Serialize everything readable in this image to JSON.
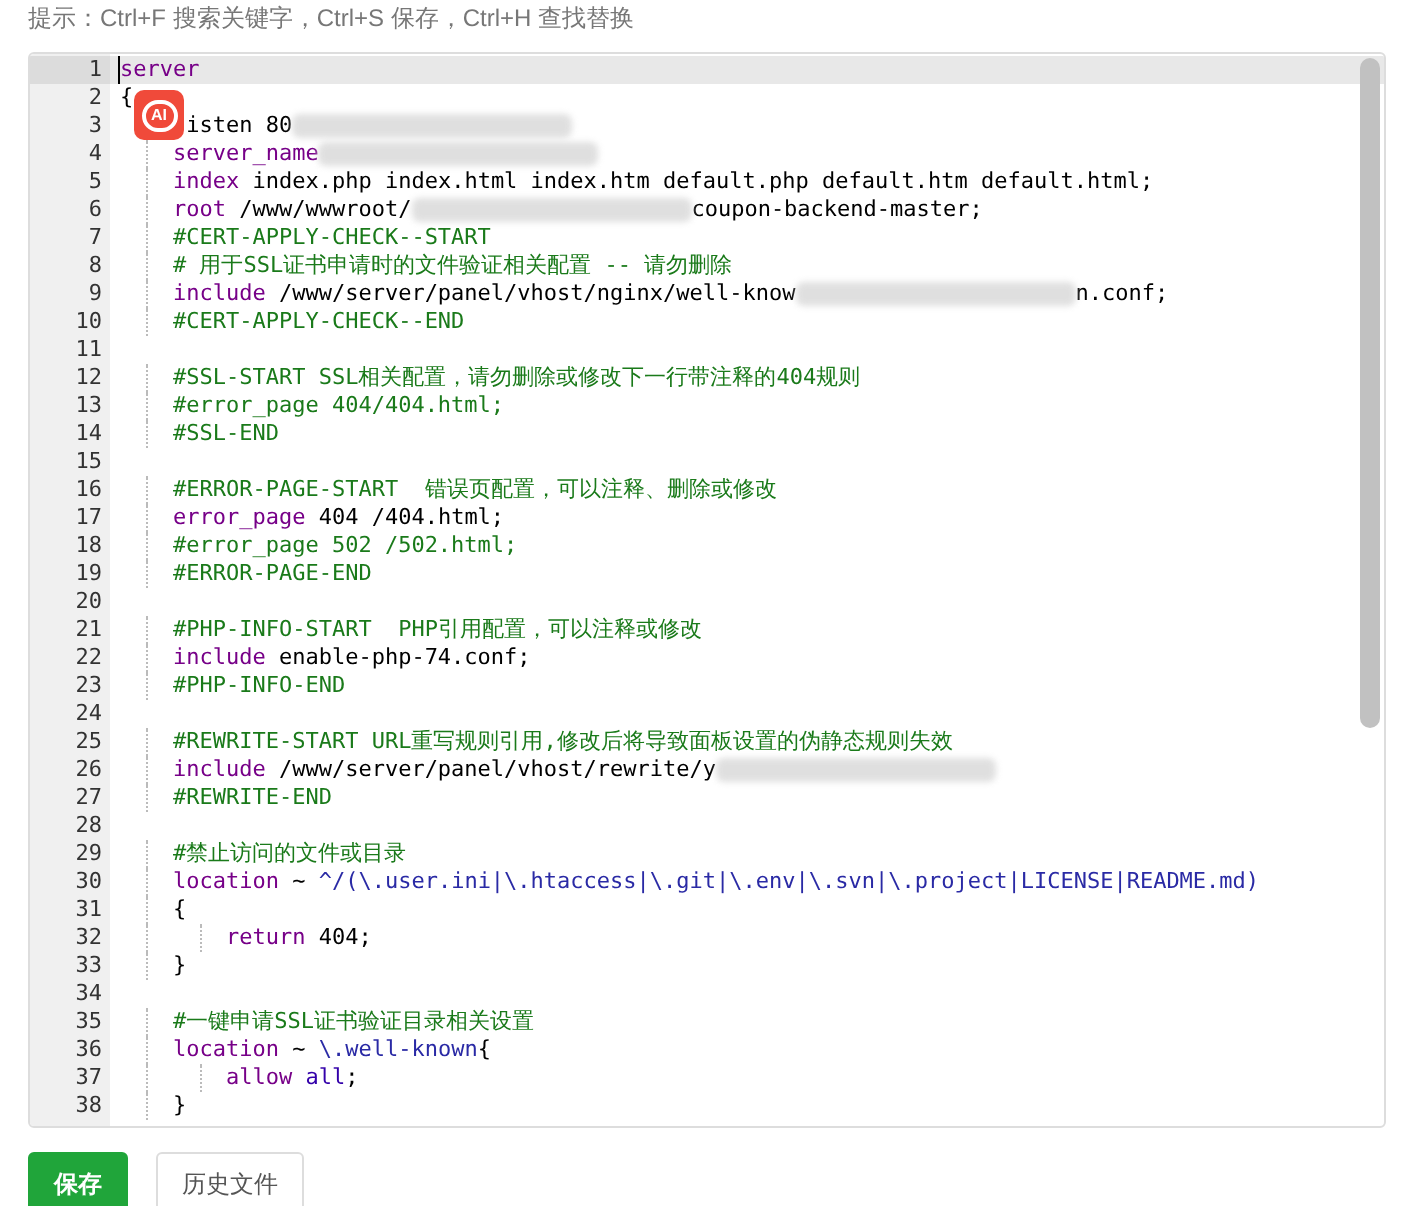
{
  "hint": "提示：Ctrl+F 搜索关键字，Ctrl+S 保存，Ctrl+H 查找替换",
  "editor": {
    "ai_badge": "AI",
    "lines": [
      {
        "number": "1",
        "current": true,
        "tokens": [
          {
            "kind": "keyword",
            "text": "server"
          }
        ]
      },
      {
        "number": "2",
        "current": false,
        "tokens": [
          {
            "kind": "plain",
            "text": "{"
          }
        ]
      },
      {
        "number": "3",
        "current": false,
        "tokens": [
          {
            "kind": "plain",
            "text": "     isten 80"
          },
          {
            "kind": "redacted"
          }
        ]
      },
      {
        "number": "4",
        "current": false,
        "tokens": [
          {
            "kind": "keyword",
            "text": "    server_name"
          },
          {
            "kind": "redacted"
          }
        ]
      },
      {
        "number": "5",
        "current": false,
        "tokens": [
          {
            "kind": "keyword",
            "text": "    index"
          },
          {
            "kind": "plain",
            "text": " index.php index.html index.htm default.php default.htm default.html;"
          }
        ]
      },
      {
        "number": "6",
        "current": false,
        "tokens": [
          {
            "kind": "keyword",
            "text": "    root"
          },
          {
            "kind": "plain",
            "text": " /www/wwwroot/"
          },
          {
            "kind": "redacted"
          },
          {
            "kind": "plain",
            "text": "coupon-backend-master;"
          }
        ]
      },
      {
        "number": "7",
        "current": false,
        "tokens": [
          {
            "kind": "comment",
            "text": "    #CERT-APPLY-CHECK--START"
          }
        ]
      },
      {
        "number": "8",
        "current": false,
        "tokens": [
          {
            "kind": "comment",
            "text": "    # 用于SSL证书申请时的文件验证相关配置 -- 请勿删除"
          }
        ]
      },
      {
        "number": "9",
        "current": false,
        "tokens": [
          {
            "kind": "keyword",
            "text": "    include"
          },
          {
            "kind": "plain",
            "text": " /www/server/panel/vhost/nginx/well-know"
          },
          {
            "kind": "redacted"
          },
          {
            "kind": "plain",
            "text": "n.conf;"
          }
        ]
      },
      {
        "number": "10",
        "current": false,
        "tokens": [
          {
            "kind": "comment",
            "text": "    #CERT-APPLY-CHECK--END"
          }
        ]
      },
      {
        "number": "11",
        "current": false
      },
      {
        "number": "12",
        "current": false,
        "tokens": [
          {
            "kind": "comment",
            "text": "    #SSL-START SSL相关配置，请勿删除或修改下一行带注释的404规则"
          }
        ]
      },
      {
        "number": "13",
        "current": false,
        "tokens": [
          {
            "kind": "comment",
            "text": "    #error_page 404/404.html;"
          }
        ]
      },
      {
        "number": "14",
        "current": false,
        "tokens": [
          {
            "kind": "comment",
            "text": "    #SSL-END"
          }
        ]
      },
      {
        "number": "15",
        "current": false
      },
      {
        "number": "16",
        "current": false,
        "tokens": [
          {
            "kind": "comment",
            "text": "    #ERROR-PAGE-START  错误页配置，可以注释、删除或修改"
          }
        ]
      },
      {
        "number": "17",
        "current": false,
        "tokens": [
          {
            "kind": "keyword",
            "text": "    error_page"
          },
          {
            "kind": "plain",
            "text": " 404 /404.html;"
          }
        ]
      },
      {
        "number": "18",
        "current": false,
        "tokens": [
          {
            "kind": "comment",
            "text": "    #error_page 502 /502.html;"
          }
        ]
      },
      {
        "number": "19",
        "current": false,
        "tokens": [
          {
            "kind": "comment",
            "text": "    #ERROR-PAGE-END"
          }
        ]
      },
      {
        "number": "20",
        "current": false
      },
      {
        "number": "21",
        "current": false,
        "tokens": [
          {
            "kind": "comment",
            "text": "    #PHP-INFO-START  PHP引用配置，可以注释或修改"
          }
        ]
      },
      {
        "number": "22",
        "current": false,
        "tokens": [
          {
            "kind": "keyword",
            "text": "    include"
          },
          {
            "kind": "plain",
            "text": " enable-php-74.conf;"
          }
        ]
      },
      {
        "number": "23",
        "current": false,
        "tokens": [
          {
            "kind": "comment",
            "text": "    #PHP-INFO-END"
          }
        ]
      },
      {
        "number": "24",
        "current": false
      },
      {
        "number": "25",
        "current": false,
        "tokens": [
          {
            "kind": "comment",
            "text": "    #REWRITE-START URL重写规则引用,修改后将导致面板设置的伪静态规则失效"
          }
        ]
      },
      {
        "number": "26",
        "current": false,
        "tokens": [
          {
            "kind": "keyword",
            "text": "    include"
          },
          {
            "kind": "plain",
            "text": " /www/server/panel/vhost/rewrite/y"
          },
          {
            "kind": "redacted"
          }
        ]
      },
      {
        "number": "27",
        "current": false,
        "tokens": [
          {
            "kind": "comment",
            "text": "    #REWRITE-END"
          }
        ]
      },
      {
        "number": "28",
        "current": false
      },
      {
        "number": "29",
        "current": false,
        "tokens": [
          {
            "kind": "comment",
            "text": "    #禁止访问的文件或目录"
          }
        ]
      },
      {
        "number": "30",
        "current": false,
        "tokens": [
          {
            "kind": "keyword",
            "text": "    location"
          },
          {
            "kind": "plain",
            "text": " ~ "
          },
          {
            "kind": "string",
            "text": "^/(\\.user.ini|\\.htaccess|\\.git|\\.env|\\.svn|\\.project|LICENSE|README.md)"
          }
        ]
      },
      {
        "number": "31",
        "current": false,
        "tokens": [
          {
            "kind": "plain",
            "text": "    {"
          }
        ]
      },
      {
        "number": "32",
        "current": false,
        "tokens": [
          {
            "kind": "keyword",
            "text": "        return"
          },
          {
            "kind": "plain",
            "text": " 404;"
          }
        ]
      },
      {
        "number": "33",
        "current": false,
        "tokens": [
          {
            "kind": "plain",
            "text": "    }"
          }
        ]
      },
      {
        "number": "34",
        "current": false
      },
      {
        "number": "35",
        "current": false,
        "tokens": [
          {
            "kind": "comment",
            "text": "    #一键申请SSL证书验证目录相关设置"
          }
        ]
      },
      {
        "number": "36",
        "current": false,
        "tokens": [
          {
            "kind": "keyword",
            "text": "    location"
          },
          {
            "kind": "plain",
            "text": " ~ "
          },
          {
            "kind": "string",
            "text": "\\.well-known"
          },
          {
            "kind": "plain",
            "text": "{"
          }
        ]
      },
      {
        "number": "37",
        "current": false,
        "tokens": [
          {
            "kind": "keyword",
            "text": "        allow"
          },
          {
            "kind": "atom",
            "text": " all"
          },
          {
            "kind": "plain",
            "text": ";"
          }
        ]
      },
      {
        "number": "38",
        "current": false,
        "tokens": [
          {
            "kind": "plain",
            "text": "    }"
          }
        ]
      }
    ]
  },
  "buttons": [
    {
      "label": "保存",
      "kind": "primary"
    },
    {
      "label": "历史文件",
      "kind": "secondary"
    }
  ]
}
